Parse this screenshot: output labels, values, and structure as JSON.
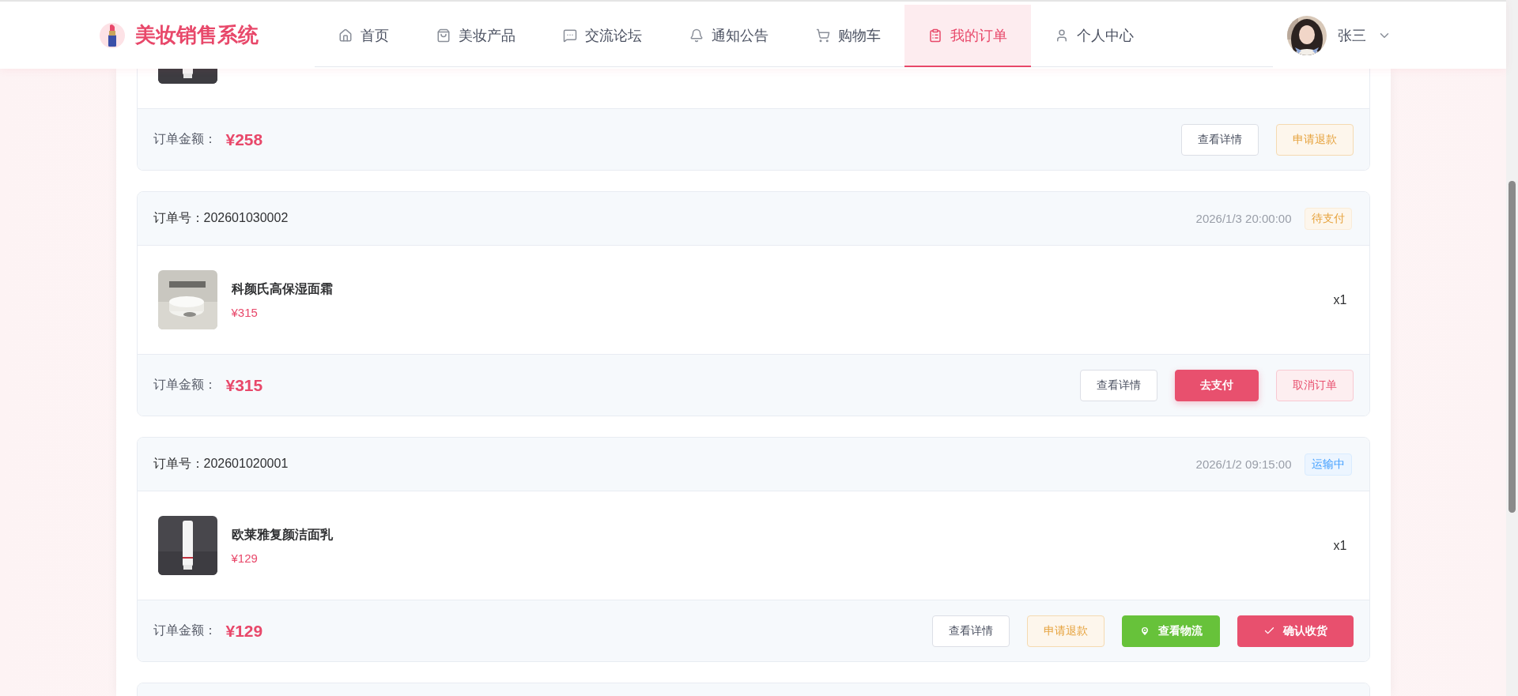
{
  "brand": {
    "title": "美妆销售系统"
  },
  "nav": [
    {
      "label": "首页",
      "selected": false
    },
    {
      "label": "美妆产品",
      "selected": false
    },
    {
      "label": "交流论坛",
      "selected": false
    },
    {
      "label": "通知公告",
      "selected": false
    },
    {
      "label": "购物车",
      "selected": false
    },
    {
      "label": "我的订单",
      "selected": true
    },
    {
      "label": "个人中心",
      "selected": false
    }
  ],
  "user": {
    "name": "张三",
    "avatar": {
      "kind": "picture"
    }
  },
  "orders": [
    {
      "cut": true,
      "items": [
        {
          "image": {
            "kind": "picture"
          }
        }
      ],
      "total_label": "订单金额：",
      "total": "¥258",
      "actions": [
        {
          "label": "查看详情",
          "kind": "default"
        },
        {
          "label": "申请退款",
          "kind": "warning"
        }
      ]
    },
    {
      "cut": false,
      "number_label": "订单号：",
      "number": "202601030002",
      "time": "2026/1/3 20:00:00",
      "status": {
        "label": "待支付",
        "kind": "pending"
      },
      "items": [
        {
          "image": {
            "kind": "picture"
          },
          "name": "科颜氏高保湿面霜",
          "price": "¥315",
          "qty": "x1"
        }
      ],
      "total_label": "订单金额：",
      "total": "¥315",
      "actions": [
        {
          "label": "查看详情",
          "kind": "default"
        },
        {
          "label": "去支付",
          "kind": "pay"
        },
        {
          "label": "取消订单",
          "kind": "cancel"
        }
      ]
    },
    {
      "cut": false,
      "number_label": "订单号：",
      "number": "202601020001",
      "time": "2026/1/2 09:15:00",
      "status": {
        "label": "运输中",
        "kind": "shipping"
      },
      "items": [
        {
          "image": {
            "kind": "picture"
          },
          "name": "欧莱雅复颜洁面乳",
          "price": "¥129",
          "qty": "x1"
        }
      ],
      "total_label": "订单金额：",
      "total": "¥129",
      "actions": [
        {
          "label": "查看详情",
          "kind": "default"
        },
        {
          "label": "申请退款",
          "kind": "warning"
        },
        {
          "label": "查看物流",
          "kind": "logistics"
        },
        {
          "label": "确认收货",
          "kind": "confirm"
        }
      ]
    }
  ]
}
